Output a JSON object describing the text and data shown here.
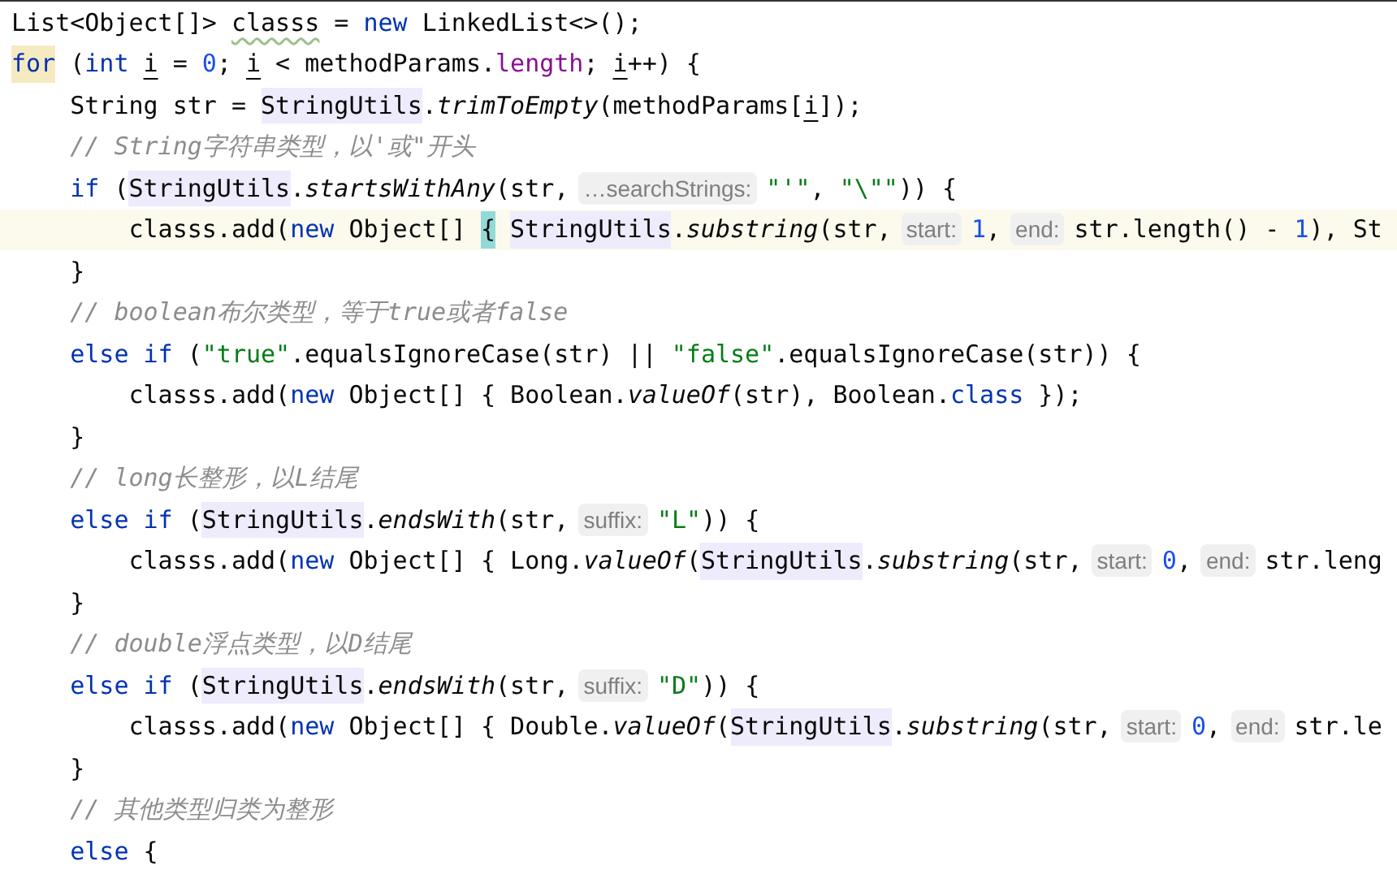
{
  "lines": [
    {
      "current": false,
      "tokens": [
        {
          "kind": "text",
          "text": "List<Object[]> "
        },
        {
          "kind": "warn",
          "text": "classs"
        },
        {
          "kind": "text",
          "text": " = "
        },
        {
          "kind": "kw",
          "text": "new"
        },
        {
          "kind": "text",
          "text": " LinkedList<>();"
        }
      ]
    },
    {
      "current": false,
      "tokens": [
        {
          "kind": "kw-mark",
          "text": "for"
        },
        {
          "kind": "text",
          "text": " ("
        },
        {
          "kind": "kw",
          "text": "int "
        },
        {
          "kind": "var",
          "text": "i"
        },
        {
          "kind": "text",
          "text": " = "
        },
        {
          "kind": "num",
          "text": "0"
        },
        {
          "kind": "text",
          "text": "; "
        },
        {
          "kind": "var",
          "text": "i"
        },
        {
          "kind": "text",
          "text": " < methodParams."
        },
        {
          "kind": "field",
          "text": "length"
        },
        {
          "kind": "text",
          "text": "; "
        },
        {
          "kind": "var",
          "text": "i"
        },
        {
          "kind": "text",
          "text": "++) {"
        }
      ]
    },
    {
      "current": false,
      "tokens": [
        {
          "kind": "text",
          "text": "    String str = "
        },
        {
          "kind": "ref",
          "text": "StringUtils"
        },
        {
          "kind": "text",
          "text": "."
        },
        {
          "kind": "method",
          "text": "trimToEmpty"
        },
        {
          "kind": "text",
          "text": "(methodParams["
        },
        {
          "kind": "var",
          "text": "i"
        },
        {
          "kind": "text",
          "text": "]);"
        }
      ]
    },
    {
      "current": false,
      "tokens": [
        {
          "kind": "cmt",
          "text": "    // String字符串类型，以'或\"开头"
        }
      ]
    },
    {
      "current": false,
      "tokens": [
        {
          "kind": "kw",
          "text": "    if"
        },
        {
          "kind": "text",
          "text": " ("
        },
        {
          "kind": "ref",
          "text": "StringUtils"
        },
        {
          "kind": "text",
          "text": "."
        },
        {
          "kind": "method",
          "text": "startsWithAny"
        },
        {
          "kind": "text",
          "text": "(str,"
        },
        {
          "kind": "hint",
          "text": "…searchStrings:"
        },
        {
          "kind": "str",
          "text": "\"'\""
        },
        {
          "kind": "text",
          "text": ", "
        },
        {
          "kind": "str",
          "text": "\"\\\"\""
        },
        {
          "kind": "text",
          "text": ")) {"
        }
      ]
    },
    {
      "current": true,
      "tokens": [
        {
          "kind": "text",
          "text": "        classs.add("
        },
        {
          "kind": "kw",
          "text": "new"
        },
        {
          "kind": "text",
          "text": " Object[] "
        },
        {
          "kind": "brace",
          "text": "{"
        },
        {
          "kind": "ref",
          "text": "StringUtils"
        },
        {
          "kind": "text",
          "text": "."
        },
        {
          "kind": "method",
          "text": "substring"
        },
        {
          "kind": "text",
          "text": "(str,"
        },
        {
          "kind": "hint",
          "text": "start:"
        },
        {
          "kind": "num",
          "text": "1"
        },
        {
          "kind": "text",
          "text": ","
        },
        {
          "kind": "hint",
          "text": "end:"
        },
        {
          "kind": "text",
          "text": "str.length() - "
        },
        {
          "kind": "num",
          "text": "1"
        },
        {
          "kind": "text",
          "text": "), St"
        }
      ]
    },
    {
      "current": false,
      "tokens": [
        {
          "kind": "text",
          "text": "    }"
        }
      ]
    },
    {
      "current": false,
      "tokens": [
        {
          "kind": "cmt",
          "text": "    // boolean布尔类型，等于true或者false"
        }
      ]
    },
    {
      "current": false,
      "tokens": [
        {
          "kind": "kw",
          "text": "    else if"
        },
        {
          "kind": "text",
          "text": " ("
        },
        {
          "kind": "str",
          "text": "\"true\""
        },
        {
          "kind": "text",
          "text": ".equalsIgnoreCase(str) || "
        },
        {
          "kind": "str",
          "text": "\"false\""
        },
        {
          "kind": "text",
          "text": ".equalsIgnoreCase(str)) {"
        }
      ]
    },
    {
      "current": false,
      "tokens": [
        {
          "kind": "text",
          "text": "        classs.add("
        },
        {
          "kind": "kw",
          "text": "new"
        },
        {
          "kind": "text",
          "text": " Object[] { Boolean."
        },
        {
          "kind": "method",
          "text": "valueOf"
        },
        {
          "kind": "text",
          "text": "(str), Boolean."
        },
        {
          "kind": "kw",
          "text": "class"
        },
        {
          "kind": "text",
          "text": " });"
        }
      ]
    },
    {
      "current": false,
      "tokens": [
        {
          "kind": "text",
          "text": "    }"
        }
      ]
    },
    {
      "current": false,
      "tokens": [
        {
          "kind": "cmt",
          "text": "    // long长整形，以L结尾"
        }
      ]
    },
    {
      "current": false,
      "tokens": [
        {
          "kind": "kw",
          "text": "    else if"
        },
        {
          "kind": "text",
          "text": " ("
        },
        {
          "kind": "ref",
          "text": "StringUtils"
        },
        {
          "kind": "text",
          "text": "."
        },
        {
          "kind": "method",
          "text": "endsWith"
        },
        {
          "kind": "text",
          "text": "(str,"
        },
        {
          "kind": "hint",
          "text": "suffix:"
        },
        {
          "kind": "str",
          "text": "\"L\""
        },
        {
          "kind": "text",
          "text": ")) {"
        }
      ]
    },
    {
      "current": false,
      "tokens": [
        {
          "kind": "text",
          "text": "        classs.add("
        },
        {
          "kind": "kw",
          "text": "new"
        },
        {
          "kind": "text",
          "text": " Object[] { Long."
        },
        {
          "kind": "method",
          "text": "valueOf"
        },
        {
          "kind": "text",
          "text": "("
        },
        {
          "kind": "ref",
          "text": "StringUtils"
        },
        {
          "kind": "text",
          "text": "."
        },
        {
          "kind": "method",
          "text": "substring"
        },
        {
          "kind": "text",
          "text": "(str,"
        },
        {
          "kind": "hint",
          "text": "start:"
        },
        {
          "kind": "num",
          "text": "0"
        },
        {
          "kind": "text",
          "text": ","
        },
        {
          "kind": "hint",
          "text": "end:"
        },
        {
          "kind": "text",
          "text": "str.leng"
        }
      ]
    },
    {
      "current": false,
      "tokens": [
        {
          "kind": "text",
          "text": "    }"
        }
      ]
    },
    {
      "current": false,
      "tokens": [
        {
          "kind": "cmt",
          "text": "    // double浮点类型，以D结尾"
        }
      ]
    },
    {
      "current": false,
      "tokens": [
        {
          "kind": "kw",
          "text": "    else if"
        },
        {
          "kind": "text",
          "text": " ("
        },
        {
          "kind": "ref",
          "text": "StringUtils"
        },
        {
          "kind": "text",
          "text": "."
        },
        {
          "kind": "method",
          "text": "endsWith"
        },
        {
          "kind": "text",
          "text": "(str,"
        },
        {
          "kind": "hint",
          "text": "suffix:"
        },
        {
          "kind": "str",
          "text": "\"D\""
        },
        {
          "kind": "text",
          "text": ")) {"
        }
      ]
    },
    {
      "current": false,
      "tokens": [
        {
          "kind": "text",
          "text": "        classs.add("
        },
        {
          "kind": "kw",
          "text": "new"
        },
        {
          "kind": "text",
          "text": " Object[] { Double."
        },
        {
          "kind": "method",
          "text": "valueOf"
        },
        {
          "kind": "text",
          "text": "("
        },
        {
          "kind": "ref",
          "text": "StringUtils"
        },
        {
          "kind": "text",
          "text": "."
        },
        {
          "kind": "method",
          "text": "substring"
        },
        {
          "kind": "text",
          "text": "(str,"
        },
        {
          "kind": "hint",
          "text": "start:"
        },
        {
          "kind": "num",
          "text": "0"
        },
        {
          "kind": "text",
          "text": ","
        },
        {
          "kind": "hint",
          "text": "end:"
        },
        {
          "kind": "text",
          "text": "str.le"
        }
      ]
    },
    {
      "current": false,
      "tokens": [
        {
          "kind": "text",
          "text": "    }"
        }
      ]
    },
    {
      "current": false,
      "tokens": [
        {
          "kind": "cmt",
          "text": "    // 其他类型归类为整形"
        }
      ]
    },
    {
      "current": false,
      "tokens": [
        {
          "kind": "kw",
          "text": "    else"
        },
        {
          "kind": "text",
          "text": " {"
        }
      ]
    }
  ]
}
